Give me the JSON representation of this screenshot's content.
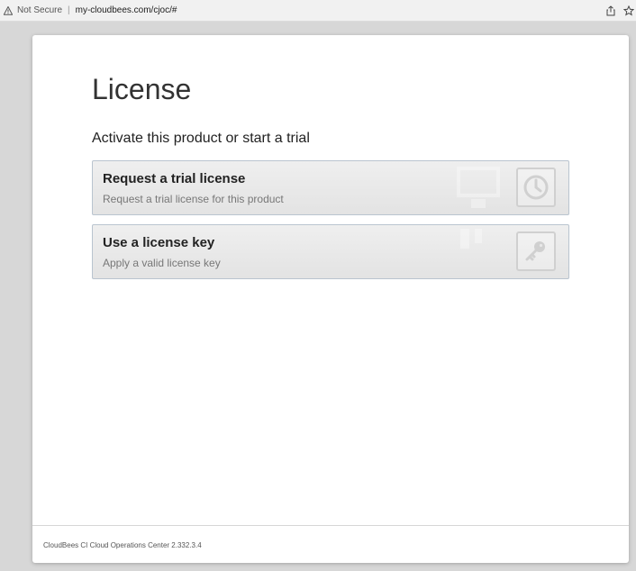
{
  "browser": {
    "security_label": "Not Secure",
    "separator": "|",
    "url": "my-cloudbees.com/cjoc/#",
    "icons": [
      "warning-icon",
      "share-icon",
      "bookmark-star-icon"
    ]
  },
  "dialog": {
    "title": "License",
    "subtitle": "Activate this product or start a trial",
    "options": [
      {
        "title": "Request a trial license",
        "description": "Request a trial license for this product",
        "icon": "clock-icon"
      },
      {
        "title": "Use a license key",
        "description": "Apply a valid license key",
        "icon": "key-icon"
      }
    ],
    "footer": "CloudBees CI Cloud Operations Center 2.332.3.4"
  }
}
